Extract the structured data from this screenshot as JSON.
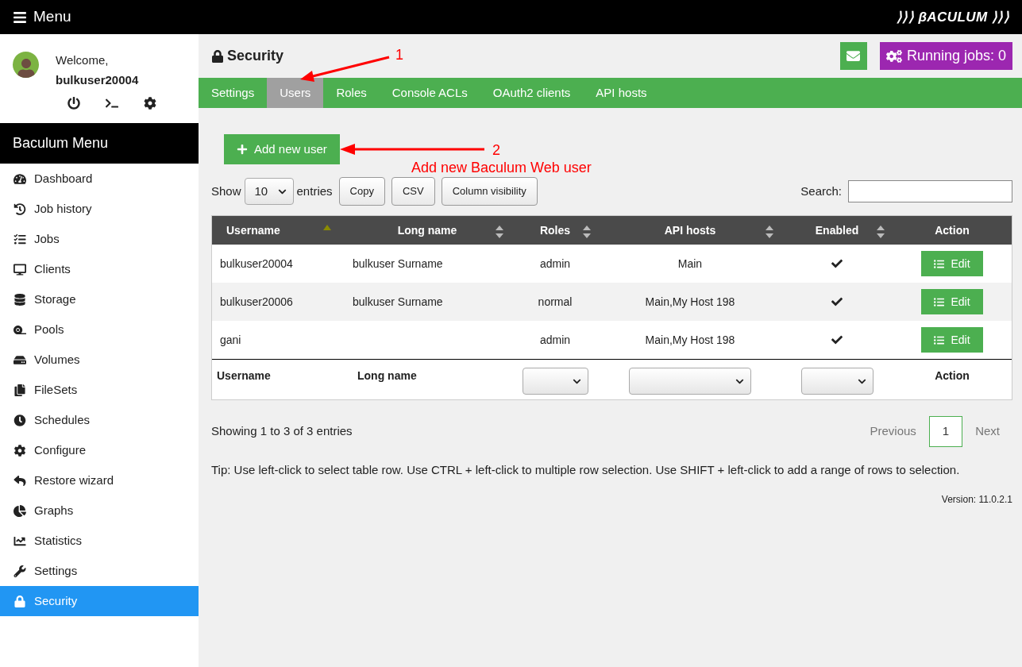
{
  "topbar": {
    "menu_label": "Menu",
    "logo": "⟩⟩⟩ βACULUM ⟩⟩⟩"
  },
  "user": {
    "welcome": "Welcome,",
    "username": "bulkuser20004"
  },
  "sidebar": {
    "title": "Baculum Menu",
    "items": [
      {
        "label": "Dashboard",
        "selected": false
      },
      {
        "label": "Job history",
        "selected": false
      },
      {
        "label": "Jobs",
        "selected": false
      },
      {
        "label": "Clients",
        "selected": false
      },
      {
        "label": "Storage",
        "selected": false
      },
      {
        "label": "Pools",
        "selected": false
      },
      {
        "label": "Volumes",
        "selected": false
      },
      {
        "label": "FileSets",
        "selected": false
      },
      {
        "label": "Schedules",
        "selected": false
      },
      {
        "label": "Configure",
        "selected": false
      },
      {
        "label": "Restore wizard",
        "selected": false
      },
      {
        "label": "Graphs",
        "selected": false
      },
      {
        "label": "Statistics",
        "selected": false
      },
      {
        "label": "Settings",
        "selected": false
      },
      {
        "label": "Security",
        "selected": true
      }
    ]
  },
  "page": {
    "title": "Security",
    "running_jobs": "Running jobs: 0"
  },
  "tabs": [
    {
      "label": "Settings",
      "selected": false
    },
    {
      "label": "Users",
      "selected": true
    },
    {
      "label": "Roles",
      "selected": false
    },
    {
      "label": "Console ACLs",
      "selected": false
    },
    {
      "label": "OAuth2 clients",
      "selected": false
    },
    {
      "label": "API hosts",
      "selected": false
    }
  ],
  "add_button": "Add new user",
  "annotations": [
    {
      "number": "1"
    },
    {
      "number": "2",
      "note": "Add new Baculum Web user"
    }
  ],
  "controls": {
    "show": "Show",
    "page_size": "10",
    "entries": "entries",
    "buttons": [
      "Copy",
      "CSV",
      "Column visibility"
    ],
    "search_label": "Search:"
  },
  "table": {
    "columns": [
      {
        "label": "Username",
        "sortable": true,
        "sorted": true
      },
      {
        "label": "Long name",
        "sortable": true,
        "sorted": false
      },
      {
        "label": "Roles",
        "sortable": true,
        "sorted": false
      },
      {
        "label": "API hosts",
        "sortable": true,
        "sorted": false
      },
      {
        "label": "Enabled",
        "sortable": true,
        "sorted": false
      },
      {
        "label": "Action",
        "sortable": false,
        "sorted": false
      }
    ],
    "rows": [
      {
        "username": "bulkuser20004",
        "long_name": "bulkuser Surname",
        "roles": "admin",
        "api_hosts": "Main",
        "enabled": true,
        "action": "Edit"
      },
      {
        "username": "bulkuser20006",
        "long_name": "bulkuser Surname",
        "roles": "normal",
        "api_hosts": "Main,My Host 198",
        "enabled": true,
        "action": "Edit"
      },
      {
        "username": "gani",
        "long_name": "",
        "roles": "admin",
        "api_hosts": "Main,My Host 198",
        "enabled": true,
        "action": "Edit"
      }
    ],
    "footer": [
      {
        "kind": "text",
        "label": "Username"
      },
      {
        "kind": "text",
        "label": "Long name"
      },
      {
        "kind": "select"
      },
      {
        "kind": "select"
      },
      {
        "kind": "select"
      },
      {
        "kind": "text",
        "label": "Action"
      }
    ]
  },
  "info": "Showing 1 to 3 of 3 entries",
  "pagination": [
    {
      "label": "Previous",
      "selected": false
    },
    {
      "label": "1",
      "selected": true
    },
    {
      "label": "Next",
      "selected": false
    }
  ],
  "tip": "Tip: Use left-click to select table row. Use CTRL + left-click to multiple row selection. Use SHIFT + left-click to add a range of rows to selection.",
  "version": "Version: 11.0.2.1"
}
